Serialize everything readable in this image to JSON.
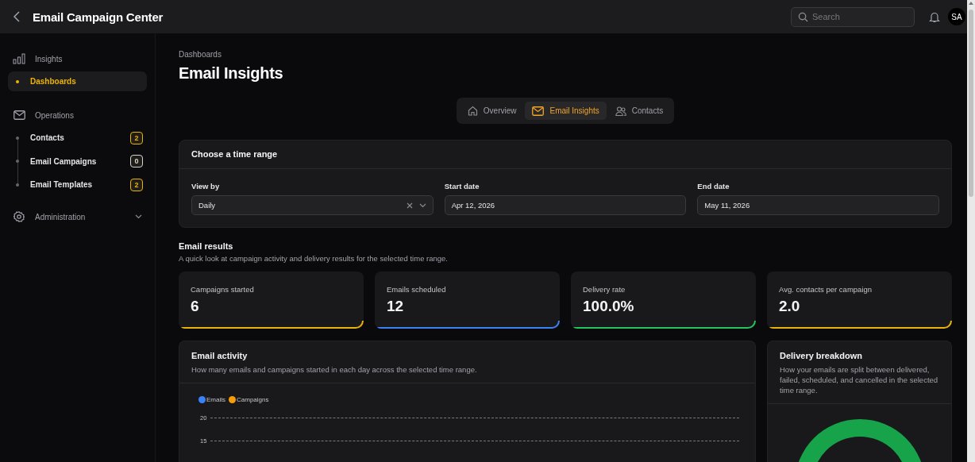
{
  "header": {
    "title": "Email Campaign Center",
    "search": {
      "placeholder": "Search"
    },
    "avatar": "SA"
  },
  "sidebar": {
    "sections": [
      {
        "label": "Insights",
        "expanded": true,
        "items": [
          {
            "label": "Dashboards",
            "selected": true
          }
        ]
      },
      {
        "label": "Operations",
        "expanded": true,
        "items": [
          {
            "label": "Contacts",
            "selected": false,
            "badge": "2",
            "color": "#eab308"
          },
          {
            "label": "Email Campaigns",
            "selected": false,
            "badge": "0",
            "color": "#d4d4d8"
          },
          {
            "label": "Email Templates",
            "selected": false,
            "badge": "2",
            "color": "#eab308"
          }
        ]
      },
      {
        "label": "Administration",
        "expanded": false
      }
    ]
  },
  "breadcrumb": "Dashboards",
  "page_title": "Email Insights",
  "tabs": [
    {
      "label": "Overview",
      "selected": false
    },
    {
      "label": "Email Insights",
      "selected": true
    },
    {
      "label": "Contacts",
      "selected": false
    }
  ],
  "time_range": {
    "title": "Choose a time range",
    "fields": [
      {
        "label": "View by",
        "kind": "select",
        "value": "Daily"
      },
      {
        "label": "Start date",
        "kind": "date",
        "value": "Apr 12, 2026"
      },
      {
        "label": "End date",
        "kind": "date",
        "value": "May 11, 2026"
      }
    ]
  },
  "results": {
    "title": "Email results",
    "subtitle": "A quick look at campaign activity and delivery results for the selected time range.",
    "cards": [
      {
        "label": "Campaigns started",
        "value": "6",
        "color": "#eab308"
      },
      {
        "label": "Emails scheduled",
        "value": "12",
        "color": "#3b82f6"
      },
      {
        "label": "Delivery rate",
        "value": "100.0%",
        "color": "#22c55e"
      },
      {
        "label": "Avg. contacts per campaign",
        "value": "2.0",
        "color": "#eab308"
      }
    ]
  },
  "activity": {
    "title": "Email activity",
    "subtitle": "How many emails and campaigns started in each day across the selected time range.",
    "legend": [
      {
        "label": "Emails",
        "color": "#3b82f6"
      },
      {
        "label": "Campaigns",
        "color": "#f59e0b"
      }
    ],
    "axis_labels": [
      "20",
      "15"
    ]
  },
  "breakdown": {
    "title": "Delivery breakdown",
    "subtitle": "How your emails are split between delivered, failed, scheduled, and cancelled in the selected time range."
  }
}
